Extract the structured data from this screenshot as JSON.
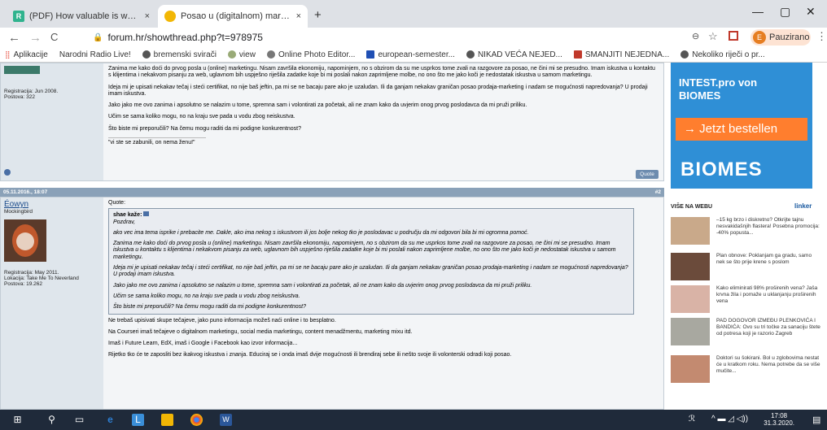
{
  "browser": {
    "tabs": [
      {
        "title": "(PDF) How valuable is word of m",
        "icon": "researchgate-icon",
        "close": "×"
      },
      {
        "title": "Posao u (digitalnom) marketingu",
        "icon": "forum-hr-icon",
        "close": "×"
      }
    ],
    "new_tab": "+",
    "window": {
      "minimize": "—",
      "maximize": "▢",
      "close": "✕"
    },
    "nav": {
      "back": "←",
      "forward": "→",
      "reload": "C"
    },
    "url": "forum.hr/showthread.php?t=978975",
    "profile_label": "Pauzirano",
    "profile_initial": "E",
    "bookmarks": [
      "Aplikacije",
      "Narodni Radio Live!",
      "bremenski svirači",
      "view",
      "Online Photo Editor...",
      "european-semester...",
      "NIKAD VEĆA NEJED...",
      "SMANJITI NEJEDNA...",
      "Nekoliko riječi o pr..."
    ]
  },
  "post1": {
    "reg": "Registracija: Jun 2008.",
    "posts": "Postova: 322",
    "paragraphs": [
      "Zanima me kako doći do prvog posla u (online) marketingu. Nisam završila ekonomiju, napominjem, no s obzirom da su me usprkos tome zvali na razgovore za posao, ne čini mi se presudno. Imam iskustva u kontaktu s klijentima i nekakvom pisanju za web, uglavnom bih uspješno riješila zadatke koje bi mi poslali nakon zaprimljene molbe, no ono što me jako koči je nedostatak iskustva u samom marketingu.",
      "Ideja mi je upisati nekakav tečaj i steći certifikat, no nije baš jeftin, pa mi se ne bacaju pare ako je uzaludan. Ili da ganjam nekakav graničan posao prodaja-marketing i nadam se mogućnosti napredovanja? U prodaji imam iskustva.",
      "Jako jako me ovo zanima i apsolutno se nalazim u tome, spremna sam i volontirati za početak, ali ne znam kako da uvjerim onog prvog poslodavca da mi pruži priliku.",
      "Učim se sama koliko mogu, no na kraju sve pada u vodu zbog neiskustva.",
      "Što biste mi preporučili? Na čemu mogu raditi da mi podigne konkurentnost?"
    ],
    "signature": "\"vi ste se zabunili, on nema ženu!\"",
    "quote_label": "Quote"
  },
  "post2": {
    "date": "05.11.2016., 18:07",
    "number": "#2",
    "username": "Éowyn",
    "rank": "Mockingbird",
    "reg": "Registracija: May 2011.",
    "location": "Lokacija: Take Me To Neverland",
    "posts": "Postova: 19.262",
    "quote_heading": "Quote:",
    "quote_author": "shae kaže:",
    "quote_paragraphs": [
      "Pozdrav,",
      "ako vec ima tema isprike i prebacite me. Dakle, ako ima nekog s iskustvom ili jos bolje nekog tko je poslodavac u području da mi odgovori bila bi mi ogromna pomoć.",
      "Zanima me kako doći do prvog posla u (online) marketingu. Nisam završila ekonomiju, napominjem, no s obzirom da su me usprkos tome zvali na razgovore za posao, ne čini mi se presudno. Imam iskustva u kontaktu s klijentima i nekakvom pisanju za web, uglavnom bih uspješno riješila zadatke koje bi mi poslali nakon zaprimljene molbe, no ono što me jako koči je nedostatak iskustva u samom marketingu.",
      "Ideja mi je upisati nekakav tečaj i steći certifikat, no nije baš jeftin, pa mi se ne bacaju pare ako je uzaludan. Ili da ganjam nekakav graničan posao prodaja-marketing i nadam se mogućnosti napredovanja? U prodaji imam iskustva.",
      "Jako jako me ovo zanima i apsolutno se nalazim u tome, spremna sam i volontirati za početak, ali ne znam kako da uvjerim onog prvog poslodavca da mi pruži priliku.",
      "Učim se sama koliko mogu, no na kraju sve pada u vodu zbog neiskustva.",
      "Što biste mi preporučili? Na čemu mogu raditi da mi podigne konkurentnost?"
    ],
    "reply_paragraphs": [
      "Ne trebaš upisivati skupe tečajeve, jako puno informacija možeš naći online i to besplatno.",
      "Na Courseri imaš tečajeve o digitalnom marketingu, social media marketingu, content menadžmentu, marketing mixu itd.",
      "Imaš i Future Learn, EdX, imaš i Google i Facebook kao izvor informacija...",
      "Rijetko tko će te zaposliti bez ikakvog iskustva i znanja. Educiraj se i onda imaš dvije mogućnosti ili brendiraj sebe ili nešto svoje ili volonterski odradi koji posao."
    ]
  },
  "ads": {
    "banner_title": "INTEST.pro von",
    "banner_title2": "BIOMES",
    "banner_cta": "→ Jetzt bestellen",
    "banner_logo": "BIOMES",
    "section_title": "VIŠE NA WEBU",
    "linker": "linker",
    "items": [
      "–15 kg brzo i diskretno? Otkrijte tajnu nesvakidašnjih flastera! Posebna promocija: -40% popusta...",
      "Plan obnove: Poklanjam ga gradu, samo nek se što prije krene s poslom",
      "Kako eliminirati 98% proširenih vena? Jaša krvna žila i pomaže u uklanjanju proširenih vena",
      "PAD DOGOVOR IZMEĐU PLENKOVIĆA I BANDIĆA: Ovo su tri točke za sanaciju štete od potresa koji je razorio Zagreb",
      "Doktori su šokirani. Bol u zglobovima nestat će u kratkom roku. Nema potrebe da se više mučite..."
    ]
  },
  "taskbar": {
    "time": "17:08",
    "date": "31.3.2020."
  }
}
